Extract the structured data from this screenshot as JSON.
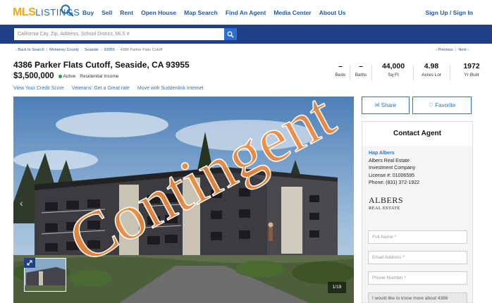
{
  "nav": {
    "logo_mls": "MLS",
    "logo_listings": "LISTINGS",
    "links": [
      "Buy",
      "Sell",
      "Rent",
      "Open House",
      "Map Search",
      "Find An Agent",
      "Media Center",
      "About Us"
    ],
    "signin": "Sign Up / Sign In"
  },
  "search": {
    "placeholder": "California City, Zip, Address, School District, MLS #"
  },
  "breadcrumb": {
    "items": [
      "Back to Search",
      "Monterey County",
      "Seaside",
      "93955",
      "4386 Parker Flats Cutoff"
    ],
    "previous": "Previous",
    "next": "Next"
  },
  "listing": {
    "address": "4386 Parker Flats Cutoff, Seaside, CA 93955",
    "price": "$3,500,000",
    "status": "Active",
    "type": "Residential Income",
    "links": [
      "View Your Credit Score",
      "Veterans: Get a Great rate",
      "Move with Suddenlink Internet"
    ],
    "stats": [
      {
        "value": "–",
        "label": "Beds"
      },
      {
        "value": "–",
        "label": "Baths"
      },
      {
        "value": "44,000",
        "label": "Sq Ft"
      },
      {
        "value": "4.98",
        "label": "Acres Lot"
      },
      {
        "value": "1972",
        "label": "Yr Built"
      }
    ]
  },
  "photo": {
    "counter": "1/19"
  },
  "actions": {
    "share": "Share",
    "favorite": "Favorite"
  },
  "contact": {
    "title": "Contact Agent",
    "agent_name": "Hap Albers",
    "company_line1": "Albers Real Estate",
    "company_line2": "Investment Company",
    "license": "License #: 01006595",
    "phone": "Phone: (831) 372-1922",
    "logo_line1": "ALBERS",
    "logo_line2": "REAL ESTATE",
    "full_name_placeholder": "Full Name *",
    "email_placeholder": "Email Address *",
    "phone_placeholder": "Phone Number *",
    "message": "I would like to know more about 4386"
  },
  "watermark": {
    "text": "Contingent",
    "color": "#f08a3c"
  }
}
